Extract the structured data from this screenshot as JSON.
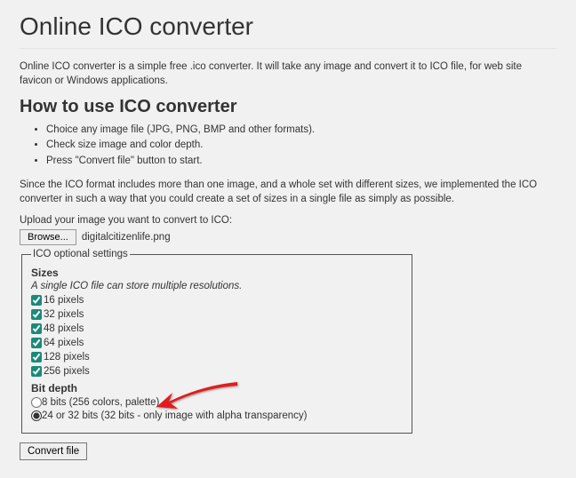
{
  "page": {
    "title": "Online ICO converter",
    "intro": "Online ICO converter is a simple free .ico converter. It will take any image and convert it to ICO file, for web site favicon or Windows applications.",
    "howto_heading": "How to use ICO converter",
    "steps": [
      "Choice any image file (JPG, PNG, BMP and other formats).",
      "Check size image and color depth.",
      "Press \"Convert file\" button to start."
    ],
    "explanation": "Since the ICO format includes more than one image, and a whole set with different sizes, we implemented the ICO converter in such a way that you could create a set of sizes in a single file as simply as possible.",
    "upload_label": "Upload your image you want to convert to ICO:",
    "browse_button": "Browse...",
    "filename": "digitalcitizenlife.png"
  },
  "settings": {
    "legend": "ICO optional settings",
    "sizes_heading": "Sizes",
    "sizes_sub": "A single ICO file can store multiple resolutions.",
    "sizes": [
      {
        "label": "16 pixels",
        "checked": true
      },
      {
        "label": "32 pixels",
        "checked": true
      },
      {
        "label": "48 pixels",
        "checked": true
      },
      {
        "label": "64 pixels",
        "checked": true
      },
      {
        "label": "128 pixels",
        "checked": true
      },
      {
        "label": "256 pixels",
        "checked": true
      }
    ],
    "bitdepth_heading": "Bit depth",
    "bitdepth": [
      {
        "label": "8 bits (256 colors, palette)",
        "checked": false
      },
      {
        "label": "24 or 32 bits (32 bits - only image with alpha transparency)",
        "checked": true
      }
    ]
  },
  "convert_button": "Convert file"
}
